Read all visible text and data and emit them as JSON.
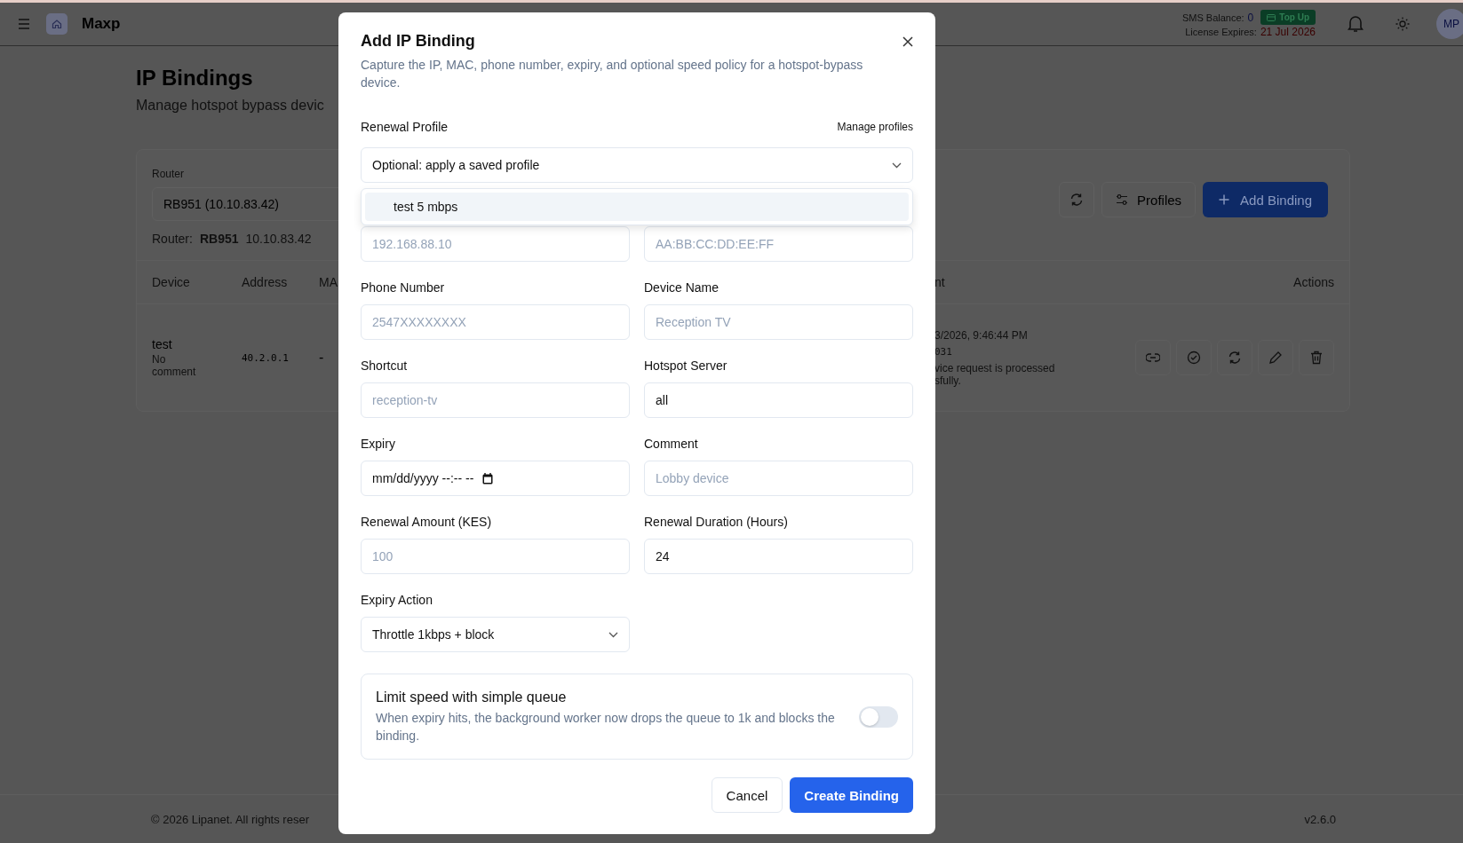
{
  "header": {
    "app_name": "Maxp",
    "sms_balance_label": "SMS Balance:",
    "sms_balance": "0",
    "top_up": "Top Up",
    "license_label": "License Expires:",
    "license_date": "21 Jul 2026",
    "avatar": "MP"
  },
  "page": {
    "title": "IP Bindings",
    "subtitle": "Manage hotspot bypass devic",
    "router_label": "Router",
    "router_select": "RB951 (10.10.83.42)",
    "router_info_label": "Router:",
    "router_name": "RB951",
    "router_ip": "10.10.83.42",
    "profiles_button": "Profiles",
    "add_button": "Add Binding",
    "table": {
      "columns": [
        "Device",
        "Address",
        "MA"
      ],
      "right_columns": [
        "nt",
        "Actions"
      ],
      "rows": [
        {
          "device": "test",
          "comment": "No comment",
          "address": "40.2.0.1",
          "mac": "-",
          "time": "3/2026, 9:46:44 PM",
          "code": "031",
          "message_lines": [
            "vice request is processed",
            "sfully."
          ]
        }
      ]
    }
  },
  "footer": {
    "copyright": "© 2026 Lipanet. All rights reser",
    "version": "v2.6.0"
  },
  "modal": {
    "title": "Add IP Binding",
    "description": "Capture the IP, MAC, phone number, expiry, and optional speed policy for a hotspot-bypass device.",
    "profile": {
      "label": "Renewal Profile",
      "link": "Manage profiles",
      "value": "Optional: apply a saved profile",
      "options": [
        {
          "label": "test 5 mbps",
          "highlighted": true
        }
      ]
    },
    "fields": [
      {
        "kind": "input",
        "placeholder": "192.168.88.10"
      },
      {
        "kind": "input",
        "placeholder": "AA:BB:CC:DD:EE:FF"
      },
      {
        "kind": "input",
        "label": "Phone Number",
        "placeholder": "2547XXXXXXXX"
      },
      {
        "kind": "input",
        "label": "Device Name",
        "placeholder": "Reception TV"
      },
      {
        "kind": "input",
        "label": "Shortcut",
        "placeholder": "reception-tv"
      },
      {
        "kind": "input",
        "label": "Hotspot Server",
        "value": "all"
      },
      {
        "kind": "datetime",
        "label": "Expiry",
        "value": "mm/dd/yyyy --:-- --"
      },
      {
        "kind": "input",
        "label": "Comment",
        "placeholder": "Lobby device"
      },
      {
        "kind": "input",
        "label": "Renewal Amount (KES)",
        "placeholder": "100"
      },
      {
        "kind": "input",
        "label": "Renewal Duration (Hours)",
        "value": "24"
      },
      {
        "kind": "select",
        "label": "Expiry Action",
        "value": "Throttle 1kbps + block"
      }
    ],
    "queue": {
      "title": "Limit speed with simple queue",
      "description": "When expiry hits, the background worker now drops the queue to 1k and blocks the binding.",
      "on": false
    },
    "cancel": "Cancel",
    "submit": "Create Binding"
  }
}
